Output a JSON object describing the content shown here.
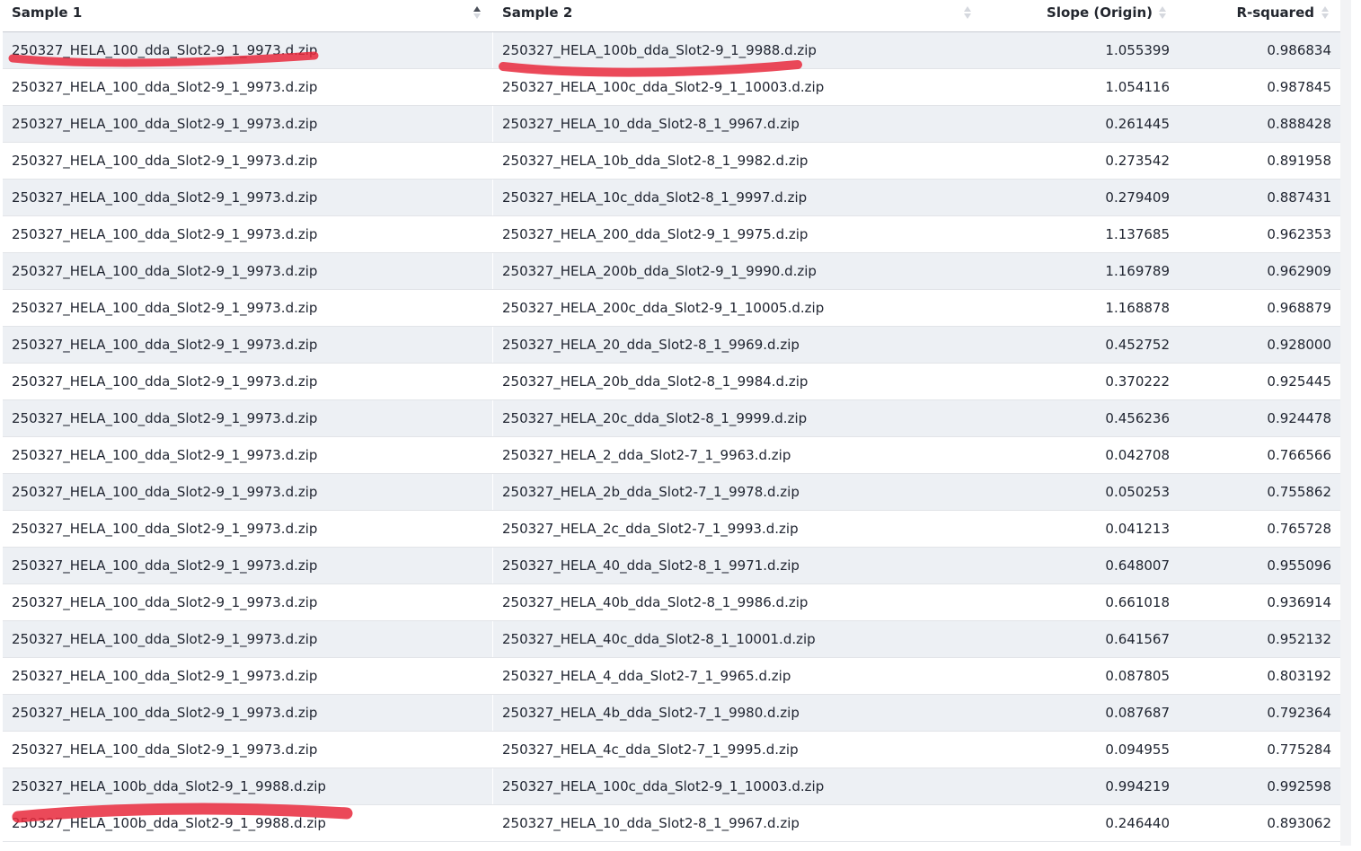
{
  "headers": {
    "sample1": "Sample 1",
    "sample2": "Sample 2",
    "slope": "Slope (Origin)",
    "r2": "R-squared"
  },
  "sort": {
    "active_column": "Sample 1",
    "direction": "ascending"
  },
  "rows": [
    {
      "sample1": "250327_HELA_100_dda_Slot2-9_1_9973.d.zip",
      "sample2": "250327_HELA_100b_dda_Slot2-9_1_9988.d.zip",
      "slope": "1.055399",
      "r2": "0.986834"
    },
    {
      "sample1": "250327_HELA_100_dda_Slot2-9_1_9973.d.zip",
      "sample2": "250327_HELA_100c_dda_Slot2-9_1_10003.d.zip",
      "slope": "1.054116",
      "r2": "0.987845"
    },
    {
      "sample1": "250327_HELA_100_dda_Slot2-9_1_9973.d.zip",
      "sample2": "250327_HELA_10_dda_Slot2-8_1_9967.d.zip",
      "slope": "0.261445",
      "r2": "0.888428"
    },
    {
      "sample1": "250327_HELA_100_dda_Slot2-9_1_9973.d.zip",
      "sample2": "250327_HELA_10b_dda_Slot2-8_1_9982.d.zip",
      "slope": "0.273542",
      "r2": "0.891958"
    },
    {
      "sample1": "250327_HELA_100_dda_Slot2-9_1_9973.d.zip",
      "sample2": "250327_HELA_10c_dda_Slot2-8_1_9997.d.zip",
      "slope": "0.279409",
      "r2": "0.887431"
    },
    {
      "sample1": "250327_HELA_100_dda_Slot2-9_1_9973.d.zip",
      "sample2": "250327_HELA_200_dda_Slot2-9_1_9975.d.zip",
      "slope": "1.137685",
      "r2": "0.962353"
    },
    {
      "sample1": "250327_HELA_100_dda_Slot2-9_1_9973.d.zip",
      "sample2": "250327_HELA_200b_dda_Slot2-9_1_9990.d.zip",
      "slope": "1.169789",
      "r2": "0.962909"
    },
    {
      "sample1": "250327_HELA_100_dda_Slot2-9_1_9973.d.zip",
      "sample2": "250327_HELA_200c_dda_Slot2-9_1_10005.d.zip",
      "slope": "1.168878",
      "r2": "0.968879"
    },
    {
      "sample1": "250327_HELA_100_dda_Slot2-9_1_9973.d.zip",
      "sample2": "250327_HELA_20_dda_Slot2-8_1_9969.d.zip",
      "slope": "0.452752",
      "r2": "0.928000"
    },
    {
      "sample1": "250327_HELA_100_dda_Slot2-9_1_9973.d.zip",
      "sample2": "250327_HELA_20b_dda_Slot2-8_1_9984.d.zip",
      "slope": "0.370222",
      "r2": "0.925445"
    },
    {
      "sample1": "250327_HELA_100_dda_Slot2-9_1_9973.d.zip",
      "sample2": "250327_HELA_20c_dda_Slot2-8_1_9999.d.zip",
      "slope": "0.456236",
      "r2": "0.924478"
    },
    {
      "sample1": "250327_HELA_100_dda_Slot2-9_1_9973.d.zip",
      "sample2": "250327_HELA_2_dda_Slot2-7_1_9963.d.zip",
      "slope": "0.042708",
      "r2": "0.766566"
    },
    {
      "sample1": "250327_HELA_100_dda_Slot2-9_1_9973.d.zip",
      "sample2": "250327_HELA_2b_dda_Slot2-7_1_9978.d.zip",
      "slope": "0.050253",
      "r2": "0.755862"
    },
    {
      "sample1": "250327_HELA_100_dda_Slot2-9_1_9973.d.zip",
      "sample2": "250327_HELA_2c_dda_Slot2-7_1_9993.d.zip",
      "slope": "0.041213",
      "r2": "0.765728"
    },
    {
      "sample1": "250327_HELA_100_dda_Slot2-9_1_9973.d.zip",
      "sample2": "250327_HELA_40_dda_Slot2-8_1_9971.d.zip",
      "slope": "0.648007",
      "r2": "0.955096"
    },
    {
      "sample1": "250327_HELA_100_dda_Slot2-9_1_9973.d.zip",
      "sample2": "250327_HELA_40b_dda_Slot2-8_1_9986.d.zip",
      "slope": "0.661018",
      "r2": "0.936914"
    },
    {
      "sample1": "250327_HELA_100_dda_Slot2-9_1_9973.d.zip",
      "sample2": "250327_HELA_40c_dda_Slot2-8_1_10001.d.zip",
      "slope": "0.641567",
      "r2": "0.952132"
    },
    {
      "sample1": "250327_HELA_100_dda_Slot2-9_1_9973.d.zip",
      "sample2": "250327_HELA_4_dda_Slot2-7_1_9965.d.zip",
      "slope": "0.087805",
      "r2": "0.803192"
    },
    {
      "sample1": "250327_HELA_100_dda_Slot2-9_1_9973.d.zip",
      "sample2": "250327_HELA_4b_dda_Slot2-7_1_9980.d.zip",
      "slope": "0.087687",
      "r2": "0.792364"
    },
    {
      "sample1": "250327_HELA_100_dda_Slot2-9_1_9973.d.zip",
      "sample2": "250327_HELA_4c_dda_Slot2-7_1_9995.d.zip",
      "slope": "0.094955",
      "r2": "0.775284"
    },
    {
      "sample1": "250327_HELA_100b_dda_Slot2-9_1_9988.d.zip",
      "sample2": "250327_HELA_100c_dda_Slot2-9_1_10003.d.zip",
      "slope": "0.994219",
      "r2": "0.992598"
    },
    {
      "sample1": "250327_HELA_100b_dda_Slot2-9_1_9988.d.zip",
      "sample2": "250327_HELA_10_dda_Slot2-8_1_9967.d.zip",
      "slope": "0.246440",
      "r2": "0.893062"
    }
  ],
  "colors": {
    "header_text": "#22262e",
    "row_stripe": "#edf0f4",
    "border": "#e2e4e8",
    "annotation_stroke": "#e8293c"
  }
}
